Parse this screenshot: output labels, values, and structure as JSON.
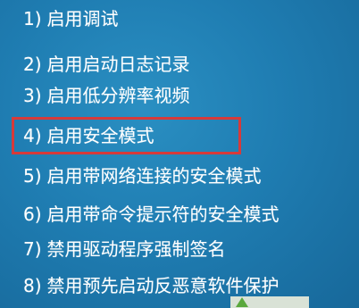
{
  "boot_options": [
    {
      "number": "1)",
      "label": "启用调试"
    },
    {
      "number": "2)",
      "label": "启用启动日志记录"
    },
    {
      "number": "3)",
      "label": "启用低分辨率视频"
    },
    {
      "number": "4)",
      "label": "启用安全模式"
    },
    {
      "number": "5)",
      "label": "启用带网络连接的安全模式"
    },
    {
      "number": "6)",
      "label": "启用带命令提示符的安全模式"
    },
    {
      "number": "7)",
      "label": "禁用驱动程序强制签名"
    },
    {
      "number": "8)",
      "label": "禁用预先启动反恶意软件保护"
    }
  ],
  "highlighted_option_index": 3,
  "colors": {
    "background": "#1f7db2",
    "text": "#ffffff",
    "highlight_border": "#d63a3a"
  }
}
